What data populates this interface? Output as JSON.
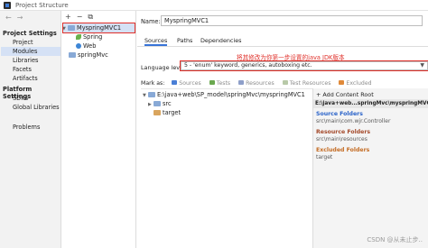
{
  "window": {
    "title": "Project Structure"
  },
  "sidebar": {
    "nav_back": "←",
    "nav_forward": "→",
    "sections": [
      {
        "header": "Project Settings",
        "items": [
          "Project",
          "Modules",
          "Libraries",
          "Facets",
          "Artifacts"
        ]
      },
      {
        "header": "Platform Settings",
        "items": [
          "SDKs",
          "Global Libraries"
        ]
      }
    ],
    "problems": "Problems",
    "selected": "Modules"
  },
  "module_tree": {
    "toolbar": {
      "add": "+",
      "remove": "−",
      "copy": "⧉"
    },
    "nodes": [
      {
        "label": "MyspringMVC1",
        "level": 0,
        "expanded": true,
        "selected": true
      },
      {
        "label": "Spring",
        "level": 1
      },
      {
        "label": "Web",
        "level": 1
      },
      {
        "label": "springMvc",
        "level": 0
      }
    ]
  },
  "module": {
    "name_label": "Name:",
    "name_value": "MyspringMVC1",
    "tabs": [
      "Sources",
      "Paths",
      "Dependencies"
    ],
    "active_tab": "Sources",
    "annotation": "将其修改为你第一步设置的java JDK版本",
    "language_level_label": "Language level:",
    "language_level_value": "5 - 'enum' keyword, generics, autoboxing etc.",
    "mark_as": {
      "label": "Mark as:",
      "tags": [
        {
          "label": "Sources",
          "color": "#4a7fd6"
        },
        {
          "label": "Tests",
          "color": "#6aa84f"
        },
        {
          "label": "Resources",
          "color": "#8e9fc9"
        },
        {
          "label": "Test Resources",
          "color": "#b8c9a8"
        },
        {
          "label": "Excluded",
          "color": "#e08a3a"
        }
      ]
    },
    "content_tree": [
      {
        "label": "E:\\java+web\\SP_model\\springMvc\\myspringMVC1",
        "level": 0,
        "expanded": true
      },
      {
        "label": "src",
        "level": 1
      },
      {
        "label": "target",
        "level": 1,
        "excluded": true
      }
    ],
    "right_panel": {
      "add_content_root": "+ Add Content Root",
      "root_path": "E:\\java+web...springMvc\\myspringMVC1",
      "source_folders_header": "Source Folders",
      "source_folders_value": "src\\main\\com.wjr.Controller",
      "resource_folders_header": "Resource Folders",
      "resource_folders_value": "src\\main\\resources",
      "excluded_folders_header": "Excluded Folders",
      "excluded_folders_value": "target"
    }
  },
  "watermark": "CSDN @从未止步..",
  "colors": {
    "selection": "#d5e1f5",
    "annotation_red": "#e0302a",
    "tab_underline": "#3874d8"
  }
}
